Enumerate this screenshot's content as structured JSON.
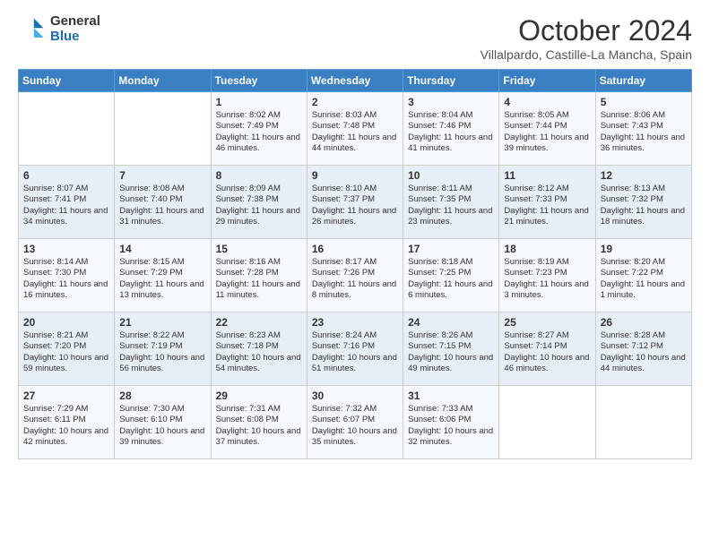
{
  "logo": {
    "general": "General",
    "blue": "Blue"
  },
  "header": {
    "title": "October 2024",
    "subtitle": "Villalpardo, Castille-La Mancha, Spain"
  },
  "weekdays": [
    "Sunday",
    "Monday",
    "Tuesday",
    "Wednesday",
    "Thursday",
    "Friday",
    "Saturday"
  ],
  "weeks": [
    [
      {
        "day": "",
        "text": ""
      },
      {
        "day": "",
        "text": ""
      },
      {
        "day": "1",
        "text": "Sunrise: 8:02 AM\nSunset: 7:49 PM\nDaylight: 11 hours and 46 minutes."
      },
      {
        "day": "2",
        "text": "Sunrise: 8:03 AM\nSunset: 7:48 PM\nDaylight: 11 hours and 44 minutes."
      },
      {
        "day": "3",
        "text": "Sunrise: 8:04 AM\nSunset: 7:46 PM\nDaylight: 11 hours and 41 minutes."
      },
      {
        "day": "4",
        "text": "Sunrise: 8:05 AM\nSunset: 7:44 PM\nDaylight: 11 hours and 39 minutes."
      },
      {
        "day": "5",
        "text": "Sunrise: 8:06 AM\nSunset: 7:43 PM\nDaylight: 11 hours and 36 minutes."
      }
    ],
    [
      {
        "day": "6",
        "text": "Sunrise: 8:07 AM\nSunset: 7:41 PM\nDaylight: 11 hours and 34 minutes."
      },
      {
        "day": "7",
        "text": "Sunrise: 8:08 AM\nSunset: 7:40 PM\nDaylight: 11 hours and 31 minutes."
      },
      {
        "day": "8",
        "text": "Sunrise: 8:09 AM\nSunset: 7:38 PM\nDaylight: 11 hours and 29 minutes."
      },
      {
        "day": "9",
        "text": "Sunrise: 8:10 AM\nSunset: 7:37 PM\nDaylight: 11 hours and 26 minutes."
      },
      {
        "day": "10",
        "text": "Sunrise: 8:11 AM\nSunset: 7:35 PM\nDaylight: 11 hours and 23 minutes."
      },
      {
        "day": "11",
        "text": "Sunrise: 8:12 AM\nSunset: 7:33 PM\nDaylight: 11 hours and 21 minutes."
      },
      {
        "day": "12",
        "text": "Sunrise: 8:13 AM\nSunset: 7:32 PM\nDaylight: 11 hours and 18 minutes."
      }
    ],
    [
      {
        "day": "13",
        "text": "Sunrise: 8:14 AM\nSunset: 7:30 PM\nDaylight: 11 hours and 16 minutes."
      },
      {
        "day": "14",
        "text": "Sunrise: 8:15 AM\nSunset: 7:29 PM\nDaylight: 11 hours and 13 minutes."
      },
      {
        "day": "15",
        "text": "Sunrise: 8:16 AM\nSunset: 7:28 PM\nDaylight: 11 hours and 11 minutes."
      },
      {
        "day": "16",
        "text": "Sunrise: 8:17 AM\nSunset: 7:26 PM\nDaylight: 11 hours and 8 minutes."
      },
      {
        "day": "17",
        "text": "Sunrise: 8:18 AM\nSunset: 7:25 PM\nDaylight: 11 hours and 6 minutes."
      },
      {
        "day": "18",
        "text": "Sunrise: 8:19 AM\nSunset: 7:23 PM\nDaylight: 11 hours and 3 minutes."
      },
      {
        "day": "19",
        "text": "Sunrise: 8:20 AM\nSunset: 7:22 PM\nDaylight: 11 hours and 1 minute."
      }
    ],
    [
      {
        "day": "20",
        "text": "Sunrise: 8:21 AM\nSunset: 7:20 PM\nDaylight: 10 hours and 59 minutes."
      },
      {
        "day": "21",
        "text": "Sunrise: 8:22 AM\nSunset: 7:19 PM\nDaylight: 10 hours and 56 minutes."
      },
      {
        "day": "22",
        "text": "Sunrise: 8:23 AM\nSunset: 7:18 PM\nDaylight: 10 hours and 54 minutes."
      },
      {
        "day": "23",
        "text": "Sunrise: 8:24 AM\nSunset: 7:16 PM\nDaylight: 10 hours and 51 minutes."
      },
      {
        "day": "24",
        "text": "Sunrise: 8:26 AM\nSunset: 7:15 PM\nDaylight: 10 hours and 49 minutes."
      },
      {
        "day": "25",
        "text": "Sunrise: 8:27 AM\nSunset: 7:14 PM\nDaylight: 10 hours and 46 minutes."
      },
      {
        "day": "26",
        "text": "Sunrise: 8:28 AM\nSunset: 7:12 PM\nDaylight: 10 hours and 44 minutes."
      }
    ],
    [
      {
        "day": "27",
        "text": "Sunrise: 7:29 AM\nSunset: 6:11 PM\nDaylight: 10 hours and 42 minutes."
      },
      {
        "day": "28",
        "text": "Sunrise: 7:30 AM\nSunset: 6:10 PM\nDaylight: 10 hours and 39 minutes."
      },
      {
        "day": "29",
        "text": "Sunrise: 7:31 AM\nSunset: 6:08 PM\nDaylight: 10 hours and 37 minutes."
      },
      {
        "day": "30",
        "text": "Sunrise: 7:32 AM\nSunset: 6:07 PM\nDaylight: 10 hours and 35 minutes."
      },
      {
        "day": "31",
        "text": "Sunrise: 7:33 AM\nSunset: 6:06 PM\nDaylight: 10 hours and 32 minutes."
      },
      {
        "day": "",
        "text": ""
      },
      {
        "day": "",
        "text": ""
      }
    ]
  ]
}
